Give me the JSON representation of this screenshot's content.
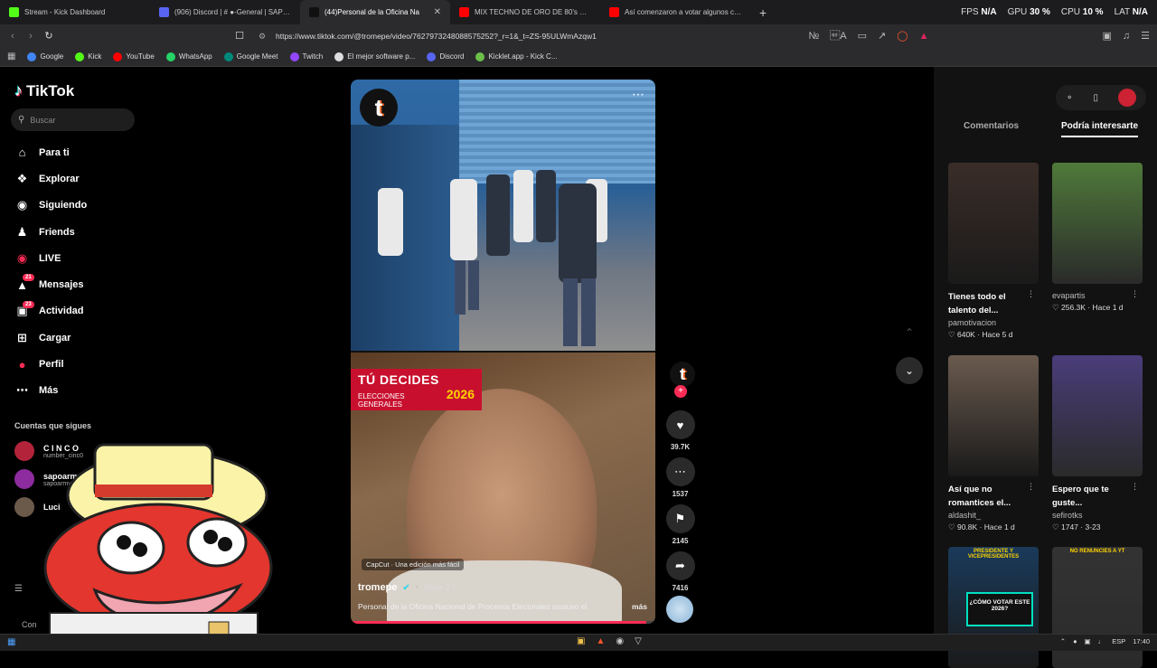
{
  "browser": {
    "tabs": [
      {
        "title": "Stream - Kick Dashboard",
        "color": "#53fc18",
        "active": false
      },
      {
        "title": "(906) Discord | # ●-General | SAPOL",
        "color": "#5865f2",
        "active": false
      },
      {
        "title": "(44)Personal de la Oficina Na",
        "color": "#111111",
        "active": true
      },
      {
        "title": "MIX TECHNO DE ORO DE 80's & 90's",
        "color": "#ff0000",
        "active": false
      },
      {
        "title": "Así comenzaron a votar algunos can",
        "color": "#ff0000",
        "active": false
      }
    ],
    "new_tab_icon": "+",
    "stats": {
      "fps_label": "FPS",
      "fps": "N/A",
      "gpu_label": "GPU",
      "gpu": "30 %",
      "cpu_label": "CPU",
      "cpu": "10 %",
      "lat_label": "LAT",
      "lat": "N/A"
    },
    "url": "https://www.tiktok.com/@tromepe/video/7627973248088575252?_r=1&_t=ZS-95ULWmAzqw1",
    "bookmarks": [
      {
        "label": "Google",
        "color": "#4285f4"
      },
      {
        "label": "Kick",
        "color": "#53fc18"
      },
      {
        "label": "YouTube",
        "color": "#ff0000"
      },
      {
        "label": "WhatsApp",
        "color": "#25d366"
      },
      {
        "label": "Google Meet",
        "color": "#00897b"
      },
      {
        "label": "Twitch",
        "color": "#9146ff"
      },
      {
        "label": "El mejor software p...",
        "color": "#dddddd"
      },
      {
        "label": "Discord",
        "color": "#5865f2"
      },
      {
        "label": "Kicklet.app - Kick C...",
        "color": "#6cc04a"
      }
    ]
  },
  "tiktok": {
    "brand": "TikTok",
    "search_placeholder": "Buscar",
    "nav": [
      {
        "label": "Para ti",
        "icon": "home-icon",
        "badge": ""
      },
      {
        "label": "Explorar",
        "icon": "compass-icon",
        "badge": ""
      },
      {
        "label": "Siguiendo",
        "icon": "following-avatar-icon",
        "badge": ""
      },
      {
        "label": "Friends",
        "icon": "friends-icon",
        "badge": ""
      },
      {
        "label": "LIVE",
        "icon": "live-icon",
        "badge": ""
      },
      {
        "label": "Mensajes",
        "icon": "messages-icon",
        "badge": "21"
      },
      {
        "label": "Actividad",
        "icon": "activity-icon",
        "badge": "23"
      },
      {
        "label": "Cargar",
        "icon": "upload-icon",
        "badge": ""
      },
      {
        "label": "Perfil",
        "icon": "profile-icon",
        "badge": ""
      },
      {
        "label": "Más",
        "icon": "more-icon",
        "badge": ""
      }
    ],
    "following_heading": "Cuentas que sigues",
    "following": [
      {
        "name": "C I N C O",
        "handle": "number_cinc0"
      },
      {
        "name": "sapoarmy",
        "handle": "sapoarmy"
      },
      {
        "name": "Luci",
        "handle": ""
      }
    ],
    "footer_partial": "Con"
  },
  "video": {
    "overlay_title": "TÚ DECIDES",
    "overlay_sub": "ELECCIONES GENERALES",
    "overlay_year": "2026",
    "capcut": "CapCut · Una edición más fácil",
    "username": "tromepe",
    "time": "Hace 2 h",
    "description": "Personal de la Oficina Nacional de Procesos Electorales sostuvo el",
    "more": "más",
    "progress": 0.97,
    "likes": "39.7K",
    "comments": "1537",
    "saves": "2145",
    "shares": "7416"
  },
  "right_panel": {
    "tabs": [
      "Comentarios",
      "Podría interesarte"
    ],
    "active_tab": 1,
    "cards": [
      {
        "title": "Tienes todo el talento del...",
        "user": "pamotivacion",
        "likes": "640K",
        "time": "Hace 5 d",
        "bg": "#3a2d28"
      },
      {
        "title": "",
        "user": "evapartis",
        "likes": "256.3K",
        "time": "Hace 1 d",
        "bg": "#4f7a3a"
      },
      {
        "title": "Así que no romantices el...",
        "user": "aldashit_",
        "likes": "90.8K",
        "time": "Hace 1 d",
        "bg": "#6a5a4e"
      },
      {
        "title": "Espero que te guste...",
        "user": "sefirotks",
        "likes": "1747",
        "time": "3-23",
        "bg": "#4a3d7a"
      },
      {
        "title": "",
        "user": "",
        "likes": "",
        "time": "",
        "bg": "#1a3a5a",
        "caption": "PRESIDENTE Y VICEPRESIDENTES"
      },
      {
        "title": "",
        "user": "",
        "likes": "",
        "time": "",
        "bg": "#333333",
        "caption": "NO RENUNCIES A YT"
      }
    ],
    "card5_sticker": "¿CÓMO VOTAR ESTE 2026?"
  },
  "taskbar": {
    "lang": "ESP",
    "clock": "17:40"
  }
}
